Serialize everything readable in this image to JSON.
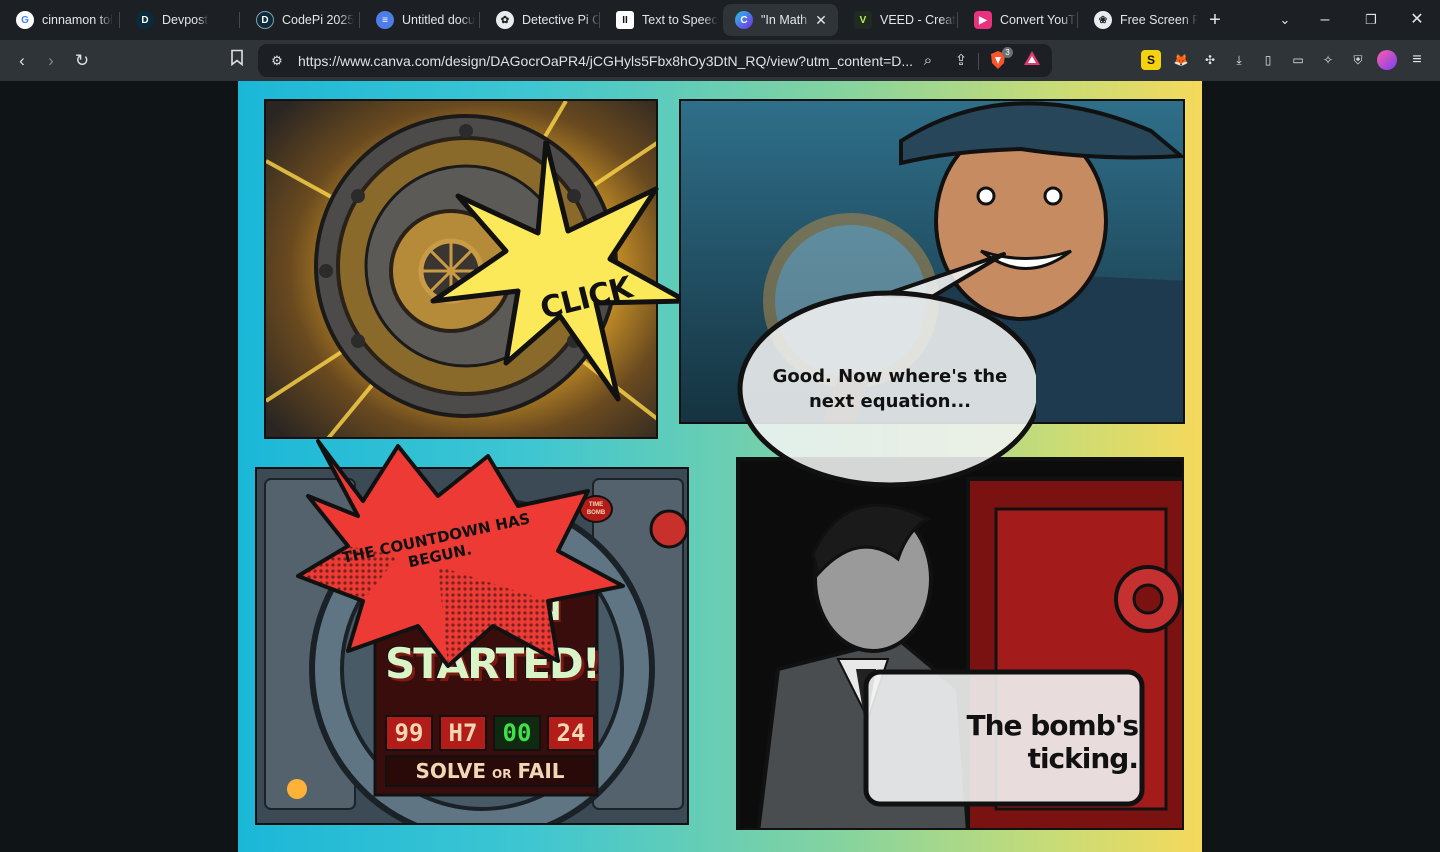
{
  "browser": {
    "tabs": [
      {
        "title": "cinnamon tol",
        "favicon": "google-icon",
        "active": false
      },
      {
        "title": "Devpost",
        "favicon": "devpost-icon",
        "active": false
      },
      {
        "title": "CodePi 2025",
        "favicon": "devpost-icon",
        "active": false
      },
      {
        "title": "Untitled docu",
        "favicon": "docs-icon",
        "active": false
      },
      {
        "title": "Detective Pi C",
        "favicon": "openai-icon",
        "active": false
      },
      {
        "title": "Text to Speec",
        "favicon": "elevenlabs-icon",
        "active": false
      },
      {
        "title": "\"In Math",
        "favicon": "canva-icon",
        "active": true
      },
      {
        "title": "VEED - Creat",
        "favicon": "veed-icon",
        "active": false
      },
      {
        "title": "Convert YouT",
        "favicon": "converter-icon",
        "active": false
      },
      {
        "title": "Free Screen F",
        "favicon": "screen-icon",
        "active": false
      }
    ],
    "url": "https://www.canva.com/design/DAGocrOaPR4/jCGHyls5Fbx8hOy3DtN_RQ/view?utm_content=D...",
    "shield_count": "3"
  },
  "comic": {
    "panel1": {
      "sfx": "CLICK"
    },
    "panel2": {
      "speech": "Good. Now where's the next equation..."
    },
    "panel3": {
      "sfx": "THE COUNTDOWN HAS BEGUN.",
      "screen_partial": "VN",
      "screen_big": "STARTED!",
      "timer": [
        "99",
        "H7",
        "00",
        "24"
      ],
      "footer_solve": "SOLVE",
      "footer_or": "OR",
      "footer_fail": "FAIL",
      "badge": "TIME BOMB"
    },
    "panel4": {
      "speech": "The bomb's ticking."
    }
  },
  "colors": {
    "accent_yellow": "#fbe95a",
    "alert_red": "#ee3a34",
    "timer_green": "#3fe04a"
  }
}
